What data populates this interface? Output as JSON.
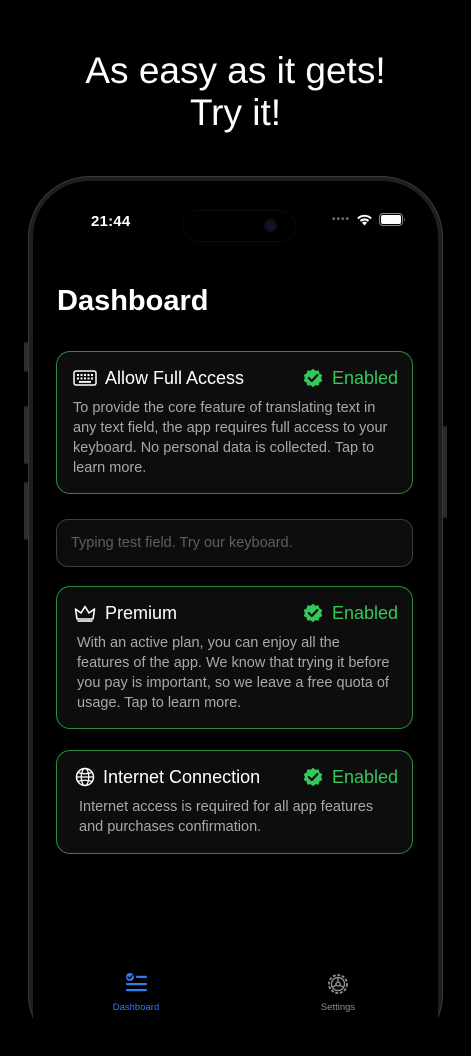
{
  "headline": {
    "line1": "As easy as it gets!",
    "line2": "Try it!"
  },
  "status_bar": {
    "time": "21:44"
  },
  "page": {
    "title": "Dashboard"
  },
  "cards": [
    {
      "title": "Allow Full Access",
      "status": "Enabled",
      "icon": "keyboard-icon",
      "description": "To provide the core feature of translating text in any text field, the app requires full access to your keyboard. No personal data is collected. Tap to learn more."
    },
    {
      "title": "Premium",
      "status": "Enabled",
      "icon": "crown-icon",
      "description": "With an active plan, you can enjoy all the features of the app. We know that trying it before you pay is important, so we leave a free quota of usage. Tap to learn more."
    },
    {
      "title": "Internet Connection",
      "status": "Enabled",
      "icon": "globe-icon",
      "description": "Internet access is required for all app features and purchases confirmation."
    }
  ],
  "test_field": {
    "placeholder": "Typing test field. Try our keyboard.",
    "value": ""
  },
  "tab_bar": {
    "items": [
      {
        "label": "Dashboard",
        "icon": "dashboard-icon",
        "active": true
      },
      {
        "label": "Settings",
        "icon": "gear-icon",
        "active": false
      }
    ]
  },
  "colors": {
    "background": "#000000",
    "accent_green": "#34c85a",
    "card_border": "#2e8a3e",
    "tab_active": "#2f7cf6",
    "tab_inactive": "#8e8e93"
  }
}
